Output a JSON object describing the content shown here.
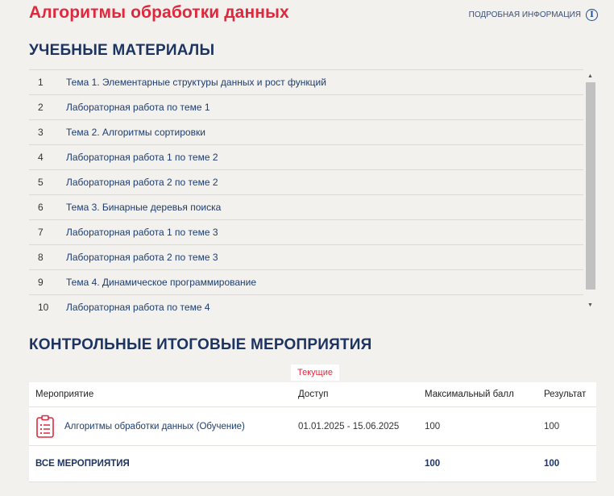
{
  "header": {
    "course_title": "Алгоритмы обработки данных",
    "info_link": "ПОДРОБНАЯ ИНФОРМАЦИЯ",
    "info_icon": "info-icon"
  },
  "materials": {
    "heading": "УЧЕБНЫЕ МАТЕРИАЛЫ",
    "items": [
      {
        "num": "1",
        "title": "Тема 1. Элементарные структуры данных и рост функций"
      },
      {
        "num": "2",
        "title": "Лабораторная работа по теме 1"
      },
      {
        "num": "3",
        "title": "Тема 2. Алгоритмы сортировки"
      },
      {
        "num": "4",
        "title": "Лабораторная работа 1 по теме 2"
      },
      {
        "num": "5",
        "title": "Лабораторная работа 2 по теме 2"
      },
      {
        "num": "6",
        "title": "Тема 3. Бинарные деревья поиска"
      },
      {
        "num": "7",
        "title": "Лабораторная работа 1 по теме 3"
      },
      {
        "num": "8",
        "title": "Лабораторная работа 2 по теме 3"
      },
      {
        "num": "9",
        "title": "Тема 4. Динамическое программирование"
      },
      {
        "num": "10",
        "title": "Лабораторная работа по теме 4"
      }
    ]
  },
  "events": {
    "heading": "КОНТРОЛЬНЫЕ ИТОГОВЫЕ МЕРОПРИЯТИЯ",
    "tab_current": "Текущие",
    "columns": {
      "event": "Мероприятие",
      "access": "Доступ",
      "max_score": "Максимальный балл",
      "result": "Результат"
    },
    "rows": [
      {
        "icon": "clipboard-list-icon",
        "name": "Алгоритмы обработки данных (Обучение)",
        "access": "01.01.2025 - 15.06.2025",
        "max_score": "100",
        "result": "100"
      }
    ],
    "total": {
      "label": "ВСЕ МЕРОПРИЯТИЯ",
      "max_score": "100",
      "result": "100"
    }
  },
  "colors": {
    "accent": "#e0283d",
    "heading": "#1d3461",
    "background": "#f2f1ee"
  }
}
